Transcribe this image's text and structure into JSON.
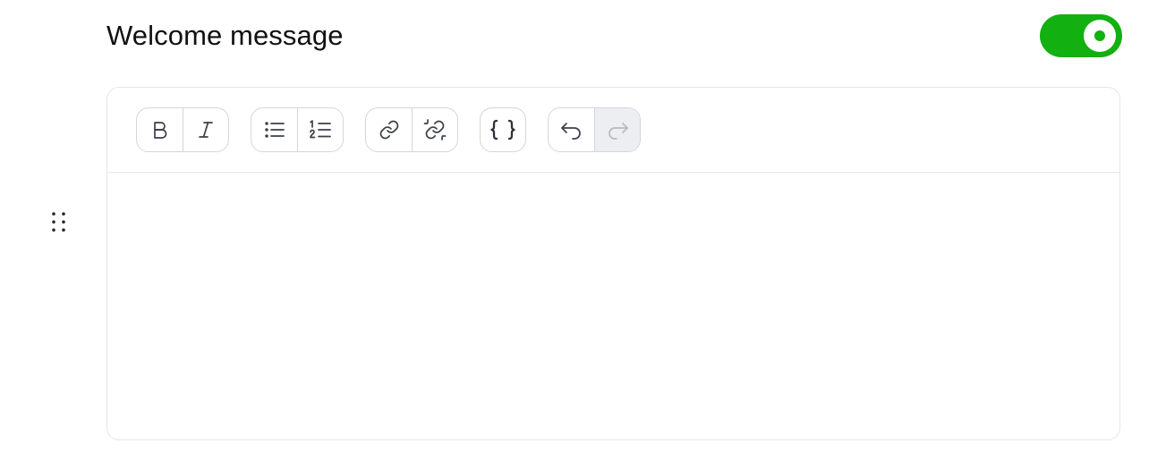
{
  "header": {
    "title": "Welcome message",
    "enabled": true
  },
  "colors": {
    "toggle_on": "#12b010",
    "border": "#e4e6ea",
    "disabled_bg": "#eceef1"
  },
  "toolbar": {
    "groups": [
      [
        "bold-icon",
        "italic-icon"
      ],
      [
        "bullet-list-icon",
        "numbered-list-icon"
      ],
      [
        "link-icon",
        "unlink-icon"
      ],
      [
        "variable-braces-icon"
      ],
      [
        "undo-icon",
        "redo-icon"
      ]
    ],
    "redo_disabled": true
  },
  "editor": {
    "content": ""
  }
}
